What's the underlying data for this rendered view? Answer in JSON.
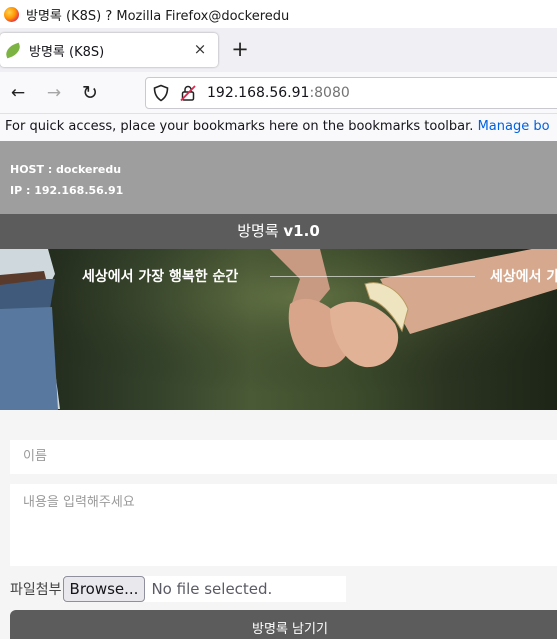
{
  "window": {
    "title": "방명록 (K8S) ? Mozilla Firefox@dockeredu"
  },
  "tabs": [
    {
      "label": "방명록 (K8S)",
      "close": "×"
    }
  ],
  "new_tab_label": "+",
  "nav": {
    "back": "←",
    "forward": "→",
    "reload": "↻"
  },
  "url": {
    "host": "192.168.56.91",
    "port": ":8080"
  },
  "bookmarks_bar": {
    "message": "For quick access, place your bookmarks here on the bookmarks toolbar.",
    "link": "Manage bo"
  },
  "page": {
    "host_label": "HOST : dockeredu",
    "ip_label": "IP : 192.168.56.91",
    "header_title": "방명록",
    "header_version": "v1.0",
    "banner_text_1": "세상에서 가장 행복한 순간",
    "banner_text_2": "세상에서 가",
    "name_placeholder": "이름",
    "content_placeholder": "내용을 입력해주세요",
    "file_label": "파일첨부",
    "browse_button": "Browse...",
    "file_status": "No file selected.",
    "submit_button": "방명록 남기기"
  },
  "colors": {
    "host_box": "#9e9e9e",
    "header_bar": "#5c5c5c",
    "submit_button": "#5c5c5c",
    "link": "#0061e0"
  }
}
